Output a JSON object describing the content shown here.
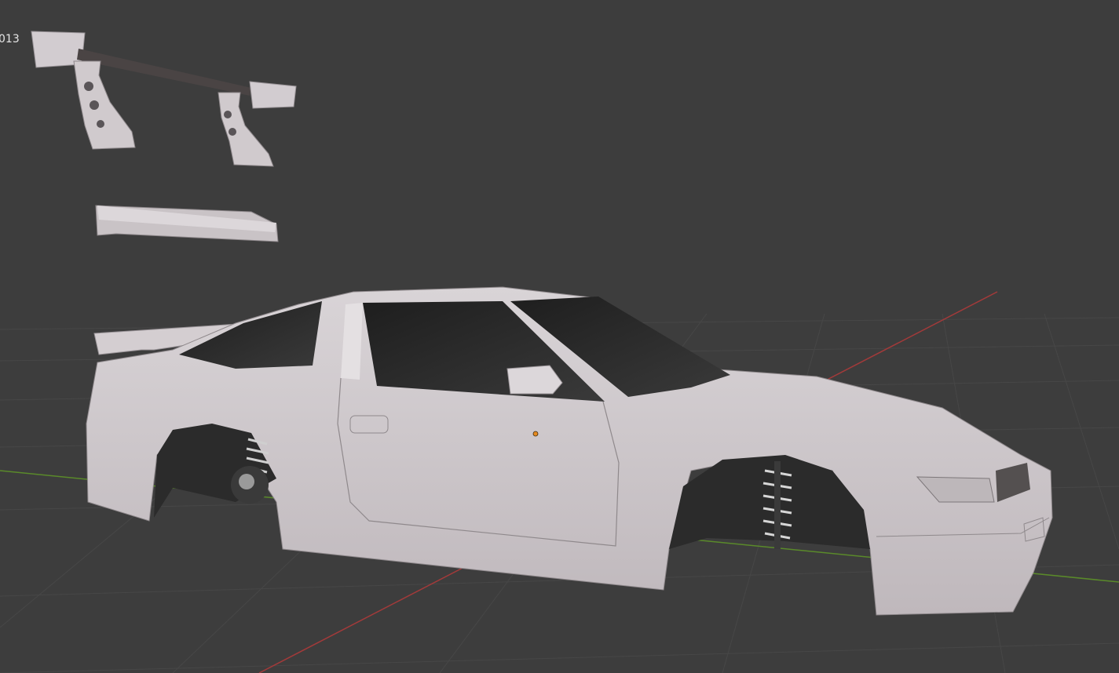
{
  "viewport": {
    "object_label": "013",
    "colors": {
      "background": "#3d3d3d",
      "grid": "#474747",
      "x_axis": "#a33a3a",
      "y_axis": "#5a8a2a",
      "body": "#cdc7cb",
      "glass": "#2f2f2f",
      "origin": "#e68a1f"
    },
    "objects": [
      "rear-wing-part",
      "side-skirt-part",
      "car-body"
    ]
  }
}
